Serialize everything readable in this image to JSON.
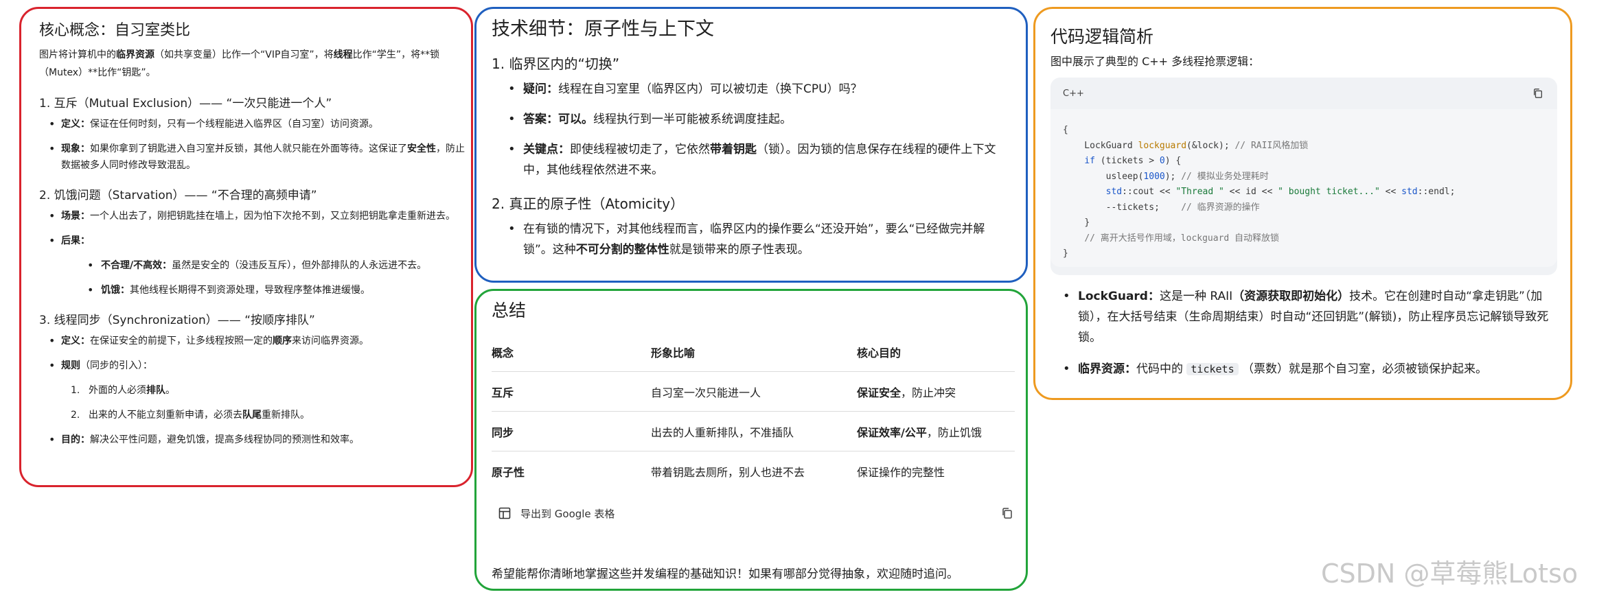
{
  "left": {
    "title": "核心概念：自习室类比",
    "intro_1": "图片将计算机中的",
    "intro_b1": "临界资源",
    "intro_2": "（如共享变量）比作一个“VIP自习室”，将",
    "intro_b2": "线程",
    "intro_3": "比作“学生”，将**锁（Mutex）**比作“钥匙”。",
    "s1": {
      "heading": "1. 互斥（Mutual Exclusion）—— “一次只能进一个人”",
      "def_label": "定义：",
      "def_text": "保证在任何时刻，只有一个线程能进入临界区（自习室）访问资源。",
      "phen_label": "现象：",
      "phen_text_1": "如果你拿到了钥匙进入自习室并反锁，其他人就只能在外面等待。这保证了",
      "phen_b": "安全性",
      "phen_text_2": "，防止数据被多人同时修改导致混乱。"
    },
    "s2": {
      "heading": "2. 饥饿问题（Starvation）—— “不合理的高频申请”",
      "scene_label": "场景：",
      "scene_text": "一个人出去了，刚把钥匙挂在墙上，因为怕下次抢不到，又立刻把钥匙拿走重新进去。",
      "result_label": "后果：",
      "r1_label": "不合理/不高效：",
      "r1_text": "虽然是安全的（没违反互斥），但外部排队的人永远进不去。",
      "r2_label": "饥饿：",
      "r2_text": "其他线程长期得不到资源处理，导致程序整体推进缓慢。"
    },
    "s3": {
      "heading": "3. 线程同步（Synchronization）—— “按顺序排队”",
      "def_label": "定义：",
      "def_text_1": "在保证安全的前提下，让多线程按照一定的",
      "def_b": "顺序",
      "def_text_2": "来访问临界资源。",
      "rule_label": "规则",
      "rule_text": "（同步的引入）：",
      "n1": "1.",
      "rule1_a": "外面的人必须",
      "rule1_b": "排队",
      "rule1_c": "。",
      "n2": "2.",
      "rule2_a": "出来的人不能立刻重新申请，必须去",
      "rule2_b": "队尾",
      "rule2_c": "重新排队。",
      "goal_label": "目的：",
      "goal_text": "解决公平性问题，避免饥饿，提高多线程协同的预测性和效率。"
    }
  },
  "mid": {
    "title": "技术细节：原子性与上下文",
    "h1": "1. 临界区内的“切换”",
    "q_label": "疑问：",
    "q_text": "线程在自习室里（临界区内）可以被切走（换下CPU）吗？",
    "a_label": "答案：",
    "a_b": "可以。",
    "a_text": "线程执行到一半可能被系统调度挂起。",
    "k_label": "关键点：",
    "k_text_1": "即使线程被切走了，它依然",
    "k_b": "带着钥匙",
    "k_text_2": "（锁）。因为锁的信息保存在线程的硬件上下文中，其他线程依然进不来。",
    "h2": "2. 真正的原子性（Atomicity）",
    "at_text_1": "在有锁的情况下，对其他线程而言，临界区内的操作要么“还没开始”，要么“已经做完并解锁”。这种",
    "at_b": "不可分割的整体性",
    "at_text_2": "就是锁带来的原子性表现。"
  },
  "summary": {
    "title": "总结",
    "headers": [
      "概念",
      "形象比喻",
      "核心目的"
    ],
    "rows": [
      {
        "c1": "互斥",
        "c2": "自习室一次只能进一人",
        "c3_b": "保证安全",
        "c3": "，防止冲突"
      },
      {
        "c1": "同步",
        "c2": "出去的人重新排队，不准插队",
        "c3_b": "保证效率/公平",
        "c3": "，防止饥饿"
      },
      {
        "c1": "原子性",
        "c2": "带着钥匙去厕所，别人也进不去",
        "c3_b": "",
        "c3": "保证操作的完整性"
      }
    ],
    "export_label": "导出到 Google 表格",
    "footer": "希望能帮你清晰地掌握这些并发编程的基础知识！如果有哪部分觉得抽象，欢迎随时追问。"
  },
  "right": {
    "title": "代码逻辑简析",
    "intro": "图中展示了典型的 C++ 多线程抢票逻辑：",
    "code_lang": "C++",
    "code": {
      "l1": "{",
      "l2a": "    LockGuard ",
      "l2fn": "lockguard",
      "l2b": "(&lock); ",
      "l2cm": "// RAII风格加锁",
      "l3kw": "if",
      "l3a": " (tickets > ",
      "l3num": "0",
      "l3b": ") {",
      "l4a": "usleep(",
      "l4num": "1000",
      "l4b": "); ",
      "l4cm": "// 模拟业务处理耗时",
      "l5ns": "std",
      "l5a": "::cout << ",
      "l5s1": "\"Thread \"",
      "l5b": " << id << ",
      "l5s2": "\" bought ticket...\"",
      "l5c": " << ",
      "l5ns2": "std",
      "l5d": "::endl;",
      "l6a": "--tickets;    ",
      "l6cm": "// 临界资源的操作",
      "l7": "}",
      "l8cm": "// 离开大括号作用域，lockguard 自动释放锁",
      "l9": "}"
    },
    "b1_label": "LockGuard：",
    "b1_text_1": "这是一种 RAII",
    "b1_b": "（资源获取即初始化）",
    "b1_text_2": "技术。它在创建时自动“拿走钥匙”（加锁），在大括号结束（生命周期结束）时自动“还回钥匙”(解锁)，防止程序员忘记解锁导致死锁。",
    "b2_label": "临界资源：",
    "b2_text_1": "代码中的",
    "b2_mono": "tickets",
    "b2_text_2": "（票数）就是那个自习室，必须被锁保护起来。"
  },
  "watermark": "CSDN @草莓熊Lotso",
  "colors": {
    "left_border": "#d9232d",
    "mid_border": "#1f5fbf",
    "summary_border": "#22a43a",
    "right_border": "#ee9a20"
  }
}
